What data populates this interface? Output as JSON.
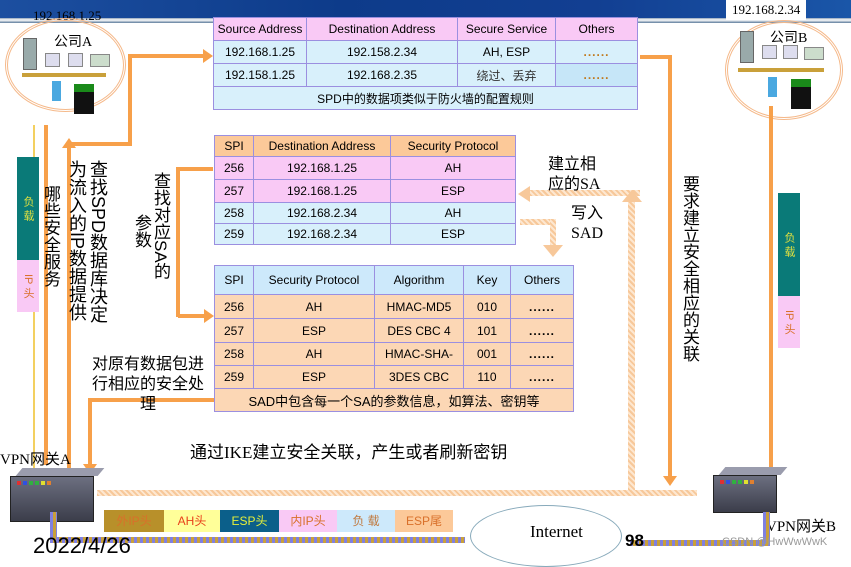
{
  "company_a": {
    "ip": "192.168.1.25",
    "name": "公司A"
  },
  "company_b": {
    "ip": "192.168.2.34",
    "name": "公司B"
  },
  "spd_table": {
    "headers": [
      "Source Address",
      "Destination Address",
      "Secure Service",
      "Others"
    ],
    "rows": [
      [
        "192.168.1.25",
        "192.158.2.34",
        "AH, ESP",
        "......"
      ],
      [
        "192.158.1.25",
        "192.168.2.35",
        "绕过、丢弃",
        "......"
      ]
    ],
    "caption": "SPD中的数据项类似于防火墙的配置规则"
  },
  "sa_table": {
    "headers": [
      "SPI",
      "Destination Address",
      "Security Protocol"
    ],
    "rows": [
      [
        "256",
        "192.168.1.25",
        "AH"
      ],
      [
        "257",
        "192.168.1.25",
        "ESP"
      ],
      [
        "258",
        "192.168.2.34",
        "AH"
      ],
      [
        "259",
        "192.168.2.34",
        "ESP"
      ]
    ]
  },
  "sad_table": {
    "headers": [
      "SPI",
      "Security Protocol",
      "Algorithm",
      "Key",
      "Others"
    ],
    "rows": [
      [
        "256",
        "AH",
        "HMAC-MD5",
        "010",
        "......"
      ],
      [
        "257",
        "ESP",
        "DES CBC 4",
        "101",
        "......"
      ],
      [
        "258",
        "AH",
        "HMAC-SHA-",
        "001",
        "......"
      ],
      [
        "259",
        "ESP",
        "3DES CBC",
        "110",
        "......"
      ]
    ],
    "caption": "SAD中包含每一个SA的参数信息，如算法、密钥等"
  },
  "annotations": {
    "which_services": "哪些安全服务",
    "lookup_spd_1": "查找SPD数据库决定",
    "lookup_spd_2": "为流入的IP数据提供",
    "lookup_sa_1": "查找对应SA的",
    "lookup_sa_2": "参数",
    "establish_sa": "建立相应的SA",
    "write_sad": "写入SAD",
    "require_sa": "要求建立安全相应的关联",
    "process_packet": "对原有数据包进行相应的安全处理",
    "ike": "通过IKE建立安全关联，产生或者刷新密钥"
  },
  "packet_left": {
    "payload": "负 载",
    "ip_header": "IP 头"
  },
  "packet_right": {
    "payload": "负 载",
    "ip_header": "IP 头"
  },
  "gateway_a": "VPN网关A",
  "gateway_b": "VPN网关B",
  "encap_packet": [
    {
      "label": "外IP头",
      "bg": "#b8902a",
      "fg": "#d9702a"
    },
    {
      "label": "AH头",
      "bg": "#ffff99",
      "fg": "#e8401a"
    },
    {
      "label": "ESP头",
      "bg": "#0b5f8a",
      "fg": "#e6f03a"
    },
    {
      "label": "内IP头",
      "bg": "#f9c9f5",
      "fg": "#d9702a"
    },
    {
      "label": "负 载",
      "bg": "#cde9fb",
      "fg": "#c07a40"
    },
    {
      "label": "ESP尾",
      "bg": "#fcc999",
      "fg": "#d9702a"
    }
  ],
  "internet": "Internet",
  "footer_date": "2022/4/26",
  "page_fragment": "98",
  "watermark": "CSDN @HwWwWwK"
}
